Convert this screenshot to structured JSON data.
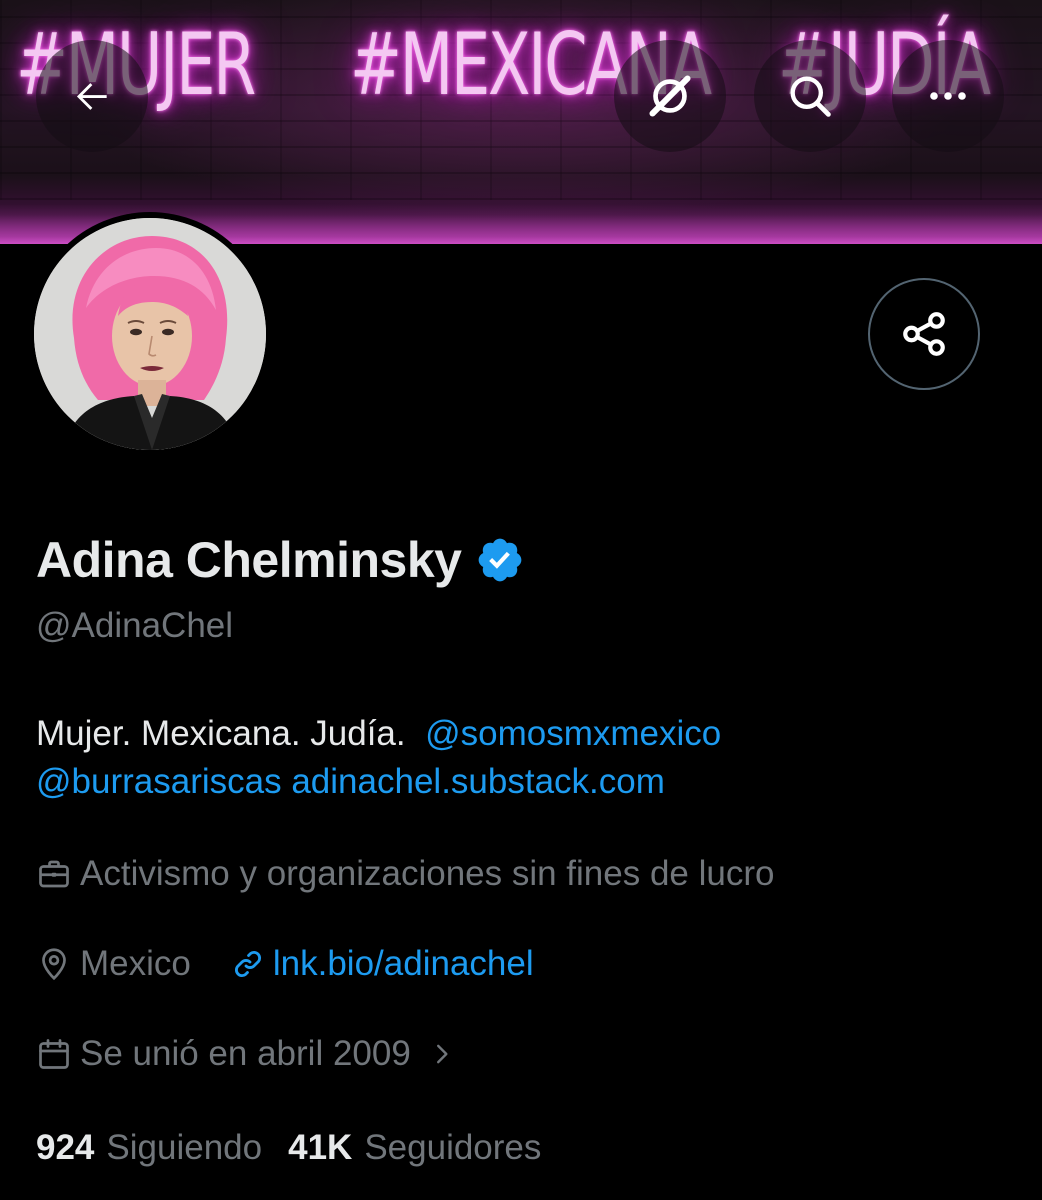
{
  "banner": {
    "neon_words": [
      "#MUJER",
      "#MEXICANA",
      "#JUDÍA"
    ]
  },
  "header": {
    "icons": [
      "back-arrow-icon",
      "grok-icon",
      "search-icon",
      "more-icon"
    ]
  },
  "profile": {
    "name": "Adina Chelminsky",
    "verified": true,
    "handle": "@AdinaChel",
    "bio": {
      "text": "Mujer. Mexicana. Judía.",
      "mention_1": "@somosmxmexico",
      "mention_2": "@burrasariscas",
      "link": "adinachel.substack.com"
    },
    "category": "Activismo y organizaciones sin fines de lucro",
    "location": "Mexico",
    "website": "lnk.bio/adinachel",
    "joined": "Se unió en abril 2009",
    "following_count": "924",
    "following_label": "Siguiendo",
    "followers_count": "41K",
    "followers_label": "Seguidores"
  },
  "colors": {
    "background": "#000000",
    "primary_text": "#e7e9ea",
    "secondary_text": "#71767b",
    "link": "#1d9bf0",
    "verified_badge": "#1d9bf0"
  }
}
